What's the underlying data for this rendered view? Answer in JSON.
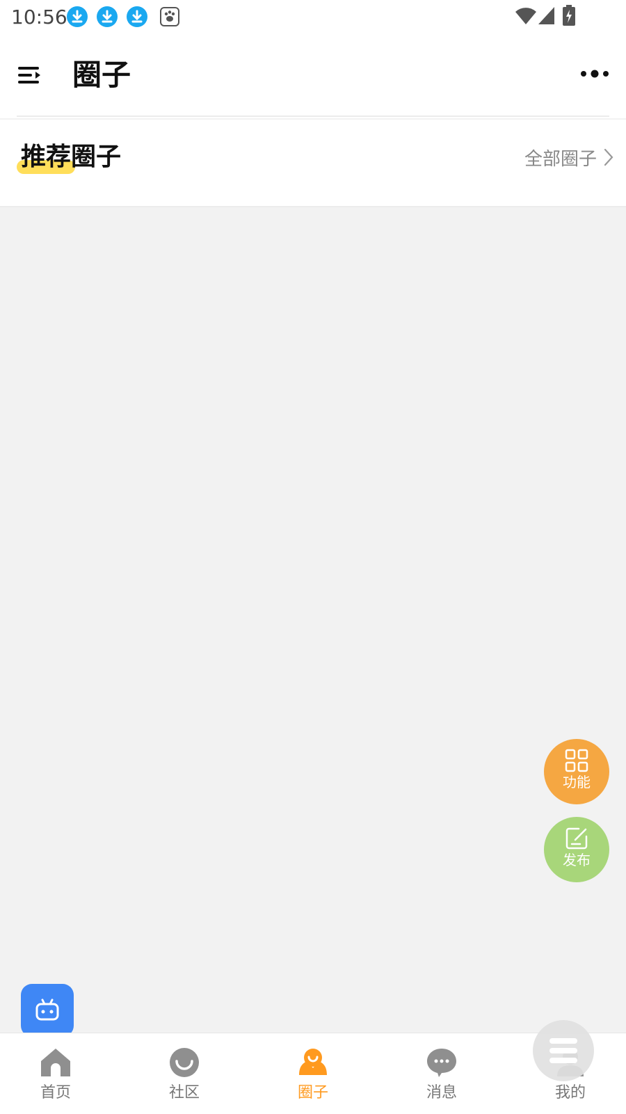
{
  "status_bar": {
    "time": "10:56",
    "notification_icons": [
      "download-icon",
      "download-icon",
      "download-icon",
      "baidu-paw-icon"
    ],
    "system_icons": [
      "wifi-icon",
      "signal-icon",
      "battery-charging-icon"
    ]
  },
  "header": {
    "title": "圈子",
    "left_icon": "menu-icon",
    "right_icon": "more-icon"
  },
  "section": {
    "title": "推荐圈子",
    "link_label": "全部圈子",
    "highlight_color": "#ffde5a"
  },
  "fabs": {
    "function_label": "功能",
    "publish_label": "发布",
    "function_color": "#f5a742",
    "publish_color": "#a8d67a"
  },
  "bot_button": {
    "icon": "bot-icon",
    "color": "#3f87f5"
  },
  "bottom_nav": {
    "items": [
      {
        "label": "首页",
        "icon": "home-icon",
        "active": false
      },
      {
        "label": "社区",
        "icon": "community-icon",
        "active": false
      },
      {
        "label": "圈子",
        "icon": "circles-icon",
        "active": true
      },
      {
        "label": "消息",
        "icon": "message-icon",
        "active": false
      },
      {
        "label": "我的",
        "icon": "profile-icon",
        "active": false
      }
    ],
    "active_color": "#ff9a1f",
    "inactive_color": "#777777"
  },
  "colors": {
    "page_background": "#f2f2f2",
    "accent": "#ff9a1f"
  }
}
